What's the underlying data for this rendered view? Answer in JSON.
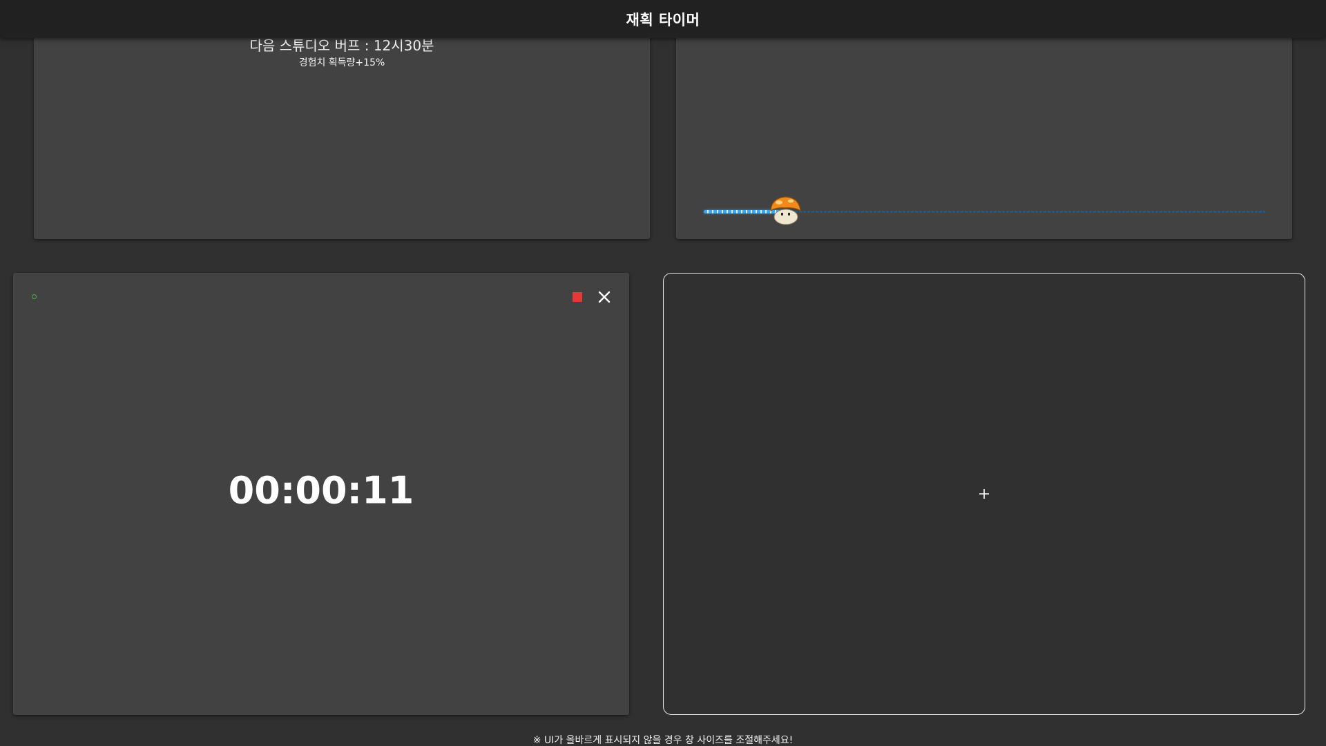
{
  "header": {
    "title": "재획 타이머"
  },
  "buff_panel": {
    "title": "다음 스튜디오 버프 : 12시30분",
    "subtitle": "경험치 획득량+15%"
  },
  "progress_panel": {
    "progress_fraction": 0.145,
    "marker_icon": "orange-mushroom-icon",
    "fill_color": "#3fa7f0"
  },
  "timer_panel": {
    "elapsed": "00:00:11",
    "status_icon": "status-dot-icon",
    "status_color": "#4caf50",
    "stop_icon": "stop-icon",
    "stop_color": "#e53935",
    "close_icon": "close-icon"
  },
  "add_panel": {
    "icon": "plus-icon"
  },
  "footer": {
    "note": "※ UI가 올바르게 표시되지 않을 경우 창 사이즈를 조절해주세요!"
  }
}
